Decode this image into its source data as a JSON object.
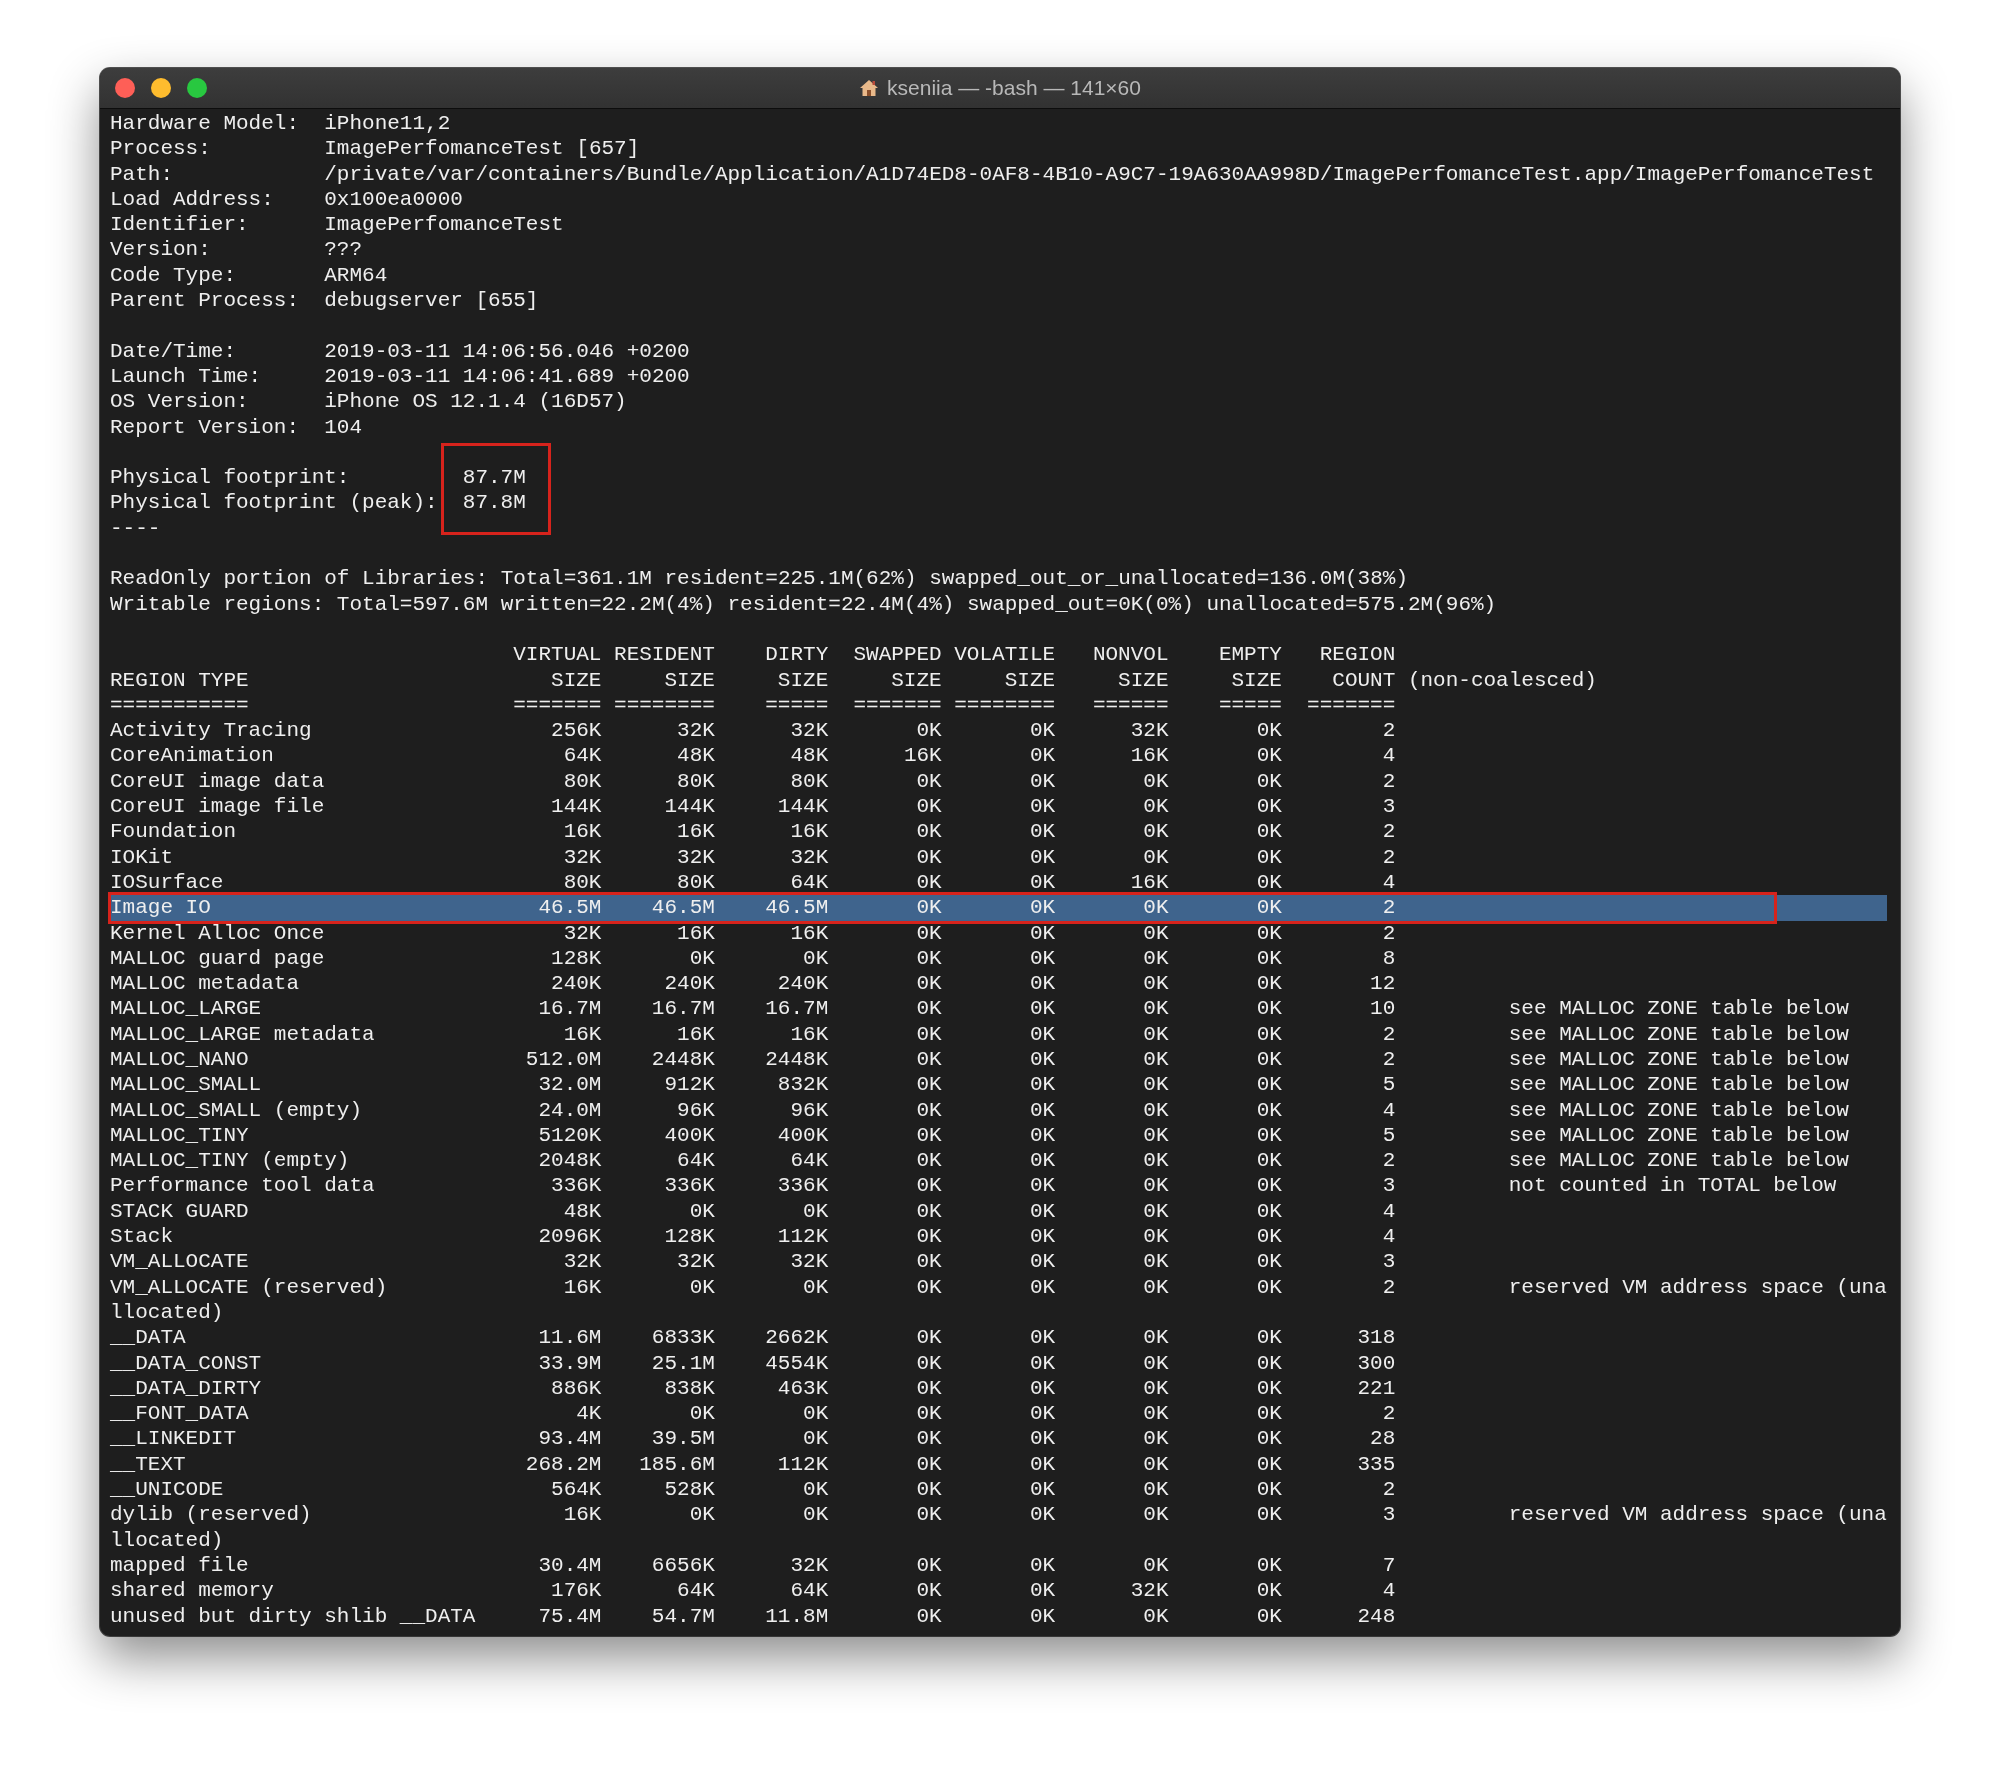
{
  "window": {
    "title": "kseniia — -bash — 141×60"
  },
  "process_info": [
    {
      "label": "Hardware Model:",
      "value": "iPhone11,2"
    },
    {
      "label": "Process:",
      "value": "ImagePerfomanceTest [657]"
    },
    {
      "label": "Path:",
      "value": "/private/var/containers/Bundle/Application/A1D74ED8-0AF8-4B10-A9C7-19A630AA998D/ImagePerfomanceTest.app/ImagePerfomanceTest"
    },
    {
      "label": "Load Address:",
      "value": "0x100ea0000"
    },
    {
      "label": "Identifier:",
      "value": "ImagePerfomanceTest"
    },
    {
      "label": "Version:",
      "value": "???"
    },
    {
      "label": "Code Type:",
      "value": "ARM64"
    },
    {
      "label": "Parent Process:",
      "value": "debugserver [655]"
    }
  ],
  "time_info": [
    {
      "label": "Date/Time:",
      "value": "2019-03-11 14:06:56.046 +0200"
    },
    {
      "label": "Launch Time:",
      "value": "2019-03-11 14:06:41.689 +0200"
    },
    {
      "label": "OS Version:",
      "value": "iPhone OS 12.1.4 (16D57)"
    },
    {
      "label": "Report Version:",
      "value": "104"
    }
  ],
  "footprint": {
    "outlined": true,
    "items": [
      {
        "label": "Physical footprint:",
        "value": "87.7M"
      },
      {
        "label": "Physical footprint (peak):",
        "value": "87.8M"
      }
    ],
    "separator": "----"
  },
  "summary": [
    "ReadOnly portion of Libraries: Total=361.1M resident=225.1M(62%) swapped_out_or_unallocated=136.0M(38%)",
    "Writable regions: Total=597.6M written=22.2M(4%) resident=22.4M(4%) swapped_out=0K(0%) unallocated=575.2M(96%)"
  ],
  "region_table": {
    "columns": [
      {
        "line_2": "REGION TYPE",
        "rule": "==========="
      },
      {
        "line_1": "VIRTUAL",
        "line_2": "SIZE",
        "rule": "======="
      },
      {
        "line_1": "RESIDENT",
        "line_2": "SIZE",
        "rule": "========"
      },
      {
        "line_1": "DIRTY",
        "line_2": "SIZE",
        "rule": "====="
      },
      {
        "line_1": "SWAPPED",
        "line_2": "SIZE",
        "rule": "======="
      },
      {
        "line_1": "VOLATILE",
        "line_2": "SIZE",
        "rule": "========"
      },
      {
        "line_1": "NONVOL",
        "line_2": "SIZE",
        "rule": "======"
      },
      {
        "line_1": "EMPTY",
        "line_2": "SIZE",
        "rule": "====="
      },
      {
        "line_1": "REGION",
        "line_2": "COUNT",
        "rule": "======="
      }
    ],
    "header_note": "(non-coalesced)",
    "rows": [
      {
        "cells": [
          "Activity Tracing",
          "256K",
          "32K",
          "32K",
          "0K",
          "0K",
          "32K",
          "0K",
          "2"
        ],
        "selected": false,
        "outlined": false
      },
      {
        "cells": [
          "CoreAnimation",
          "64K",
          "48K",
          "48K",
          "16K",
          "0K",
          "16K",
          "0K",
          "4"
        ],
        "selected": false,
        "outlined": false
      },
      {
        "cells": [
          "CoreUI image data",
          "80K",
          "80K",
          "80K",
          "0K",
          "0K",
          "0K",
          "0K",
          "2"
        ],
        "selected": false,
        "outlined": false
      },
      {
        "cells": [
          "CoreUI image file",
          "144K",
          "144K",
          "144K",
          "0K",
          "0K",
          "0K",
          "0K",
          "3"
        ],
        "selected": false,
        "outlined": false
      },
      {
        "cells": [
          "Foundation",
          "16K",
          "16K",
          "16K",
          "0K",
          "0K",
          "0K",
          "0K",
          "2"
        ],
        "selected": false,
        "outlined": false
      },
      {
        "cells": [
          "IOKit",
          "32K",
          "32K",
          "32K",
          "0K",
          "0K",
          "0K",
          "0K",
          "2"
        ],
        "selected": false,
        "outlined": false
      },
      {
        "cells": [
          "IOSurface",
          "80K",
          "80K",
          "64K",
          "0K",
          "0K",
          "16K",
          "0K",
          "4"
        ],
        "selected": false,
        "outlined": false
      },
      {
        "cells": [
          "Image IO",
          "46.5M",
          "46.5M",
          "46.5M",
          "0K",
          "0K",
          "0K",
          "0K",
          "2"
        ],
        "selected": true,
        "outlined": true
      },
      {
        "cells": [
          "Kernel Alloc Once",
          "32K",
          "16K",
          "16K",
          "0K",
          "0K",
          "0K",
          "0K",
          "2"
        ],
        "selected": false,
        "outlined": false
      },
      {
        "cells": [
          "MALLOC guard page",
          "128K",
          "0K",
          "0K",
          "0K",
          "0K",
          "0K",
          "0K",
          "8"
        ],
        "selected": false,
        "outlined": false
      },
      {
        "cells": [
          "MALLOC metadata",
          "240K",
          "240K",
          "240K",
          "0K",
          "0K",
          "0K",
          "0K",
          "12"
        ],
        "selected": false,
        "outlined": false
      },
      {
        "cells": [
          "MALLOC_LARGE",
          "16.7M",
          "16.7M",
          "16.7M",
          "0K",
          "0K",
          "0K",
          "0K",
          "10"
        ],
        "note": "see MALLOC ZONE table below",
        "selected": false,
        "outlined": false
      },
      {
        "cells": [
          "MALLOC_LARGE metadata",
          "16K",
          "16K",
          "16K",
          "0K",
          "0K",
          "0K",
          "0K",
          "2"
        ],
        "note": "see MALLOC ZONE table below",
        "selected": false,
        "outlined": false
      },
      {
        "cells": [
          "MALLOC_NANO",
          "512.0M",
          "2448K",
          "2448K",
          "0K",
          "0K",
          "0K",
          "0K",
          "2"
        ],
        "note": "see MALLOC ZONE table below",
        "selected": false,
        "outlined": false
      },
      {
        "cells": [
          "MALLOC_SMALL",
          "32.0M",
          "912K",
          "832K",
          "0K",
          "0K",
          "0K",
          "0K",
          "5"
        ],
        "note": "see MALLOC ZONE table below",
        "selected": false,
        "outlined": false
      },
      {
        "cells": [
          "MALLOC_SMALL (empty)",
          "24.0M",
          "96K",
          "96K",
          "0K",
          "0K",
          "0K",
          "0K",
          "4"
        ],
        "note": "see MALLOC ZONE table below",
        "selected": false,
        "outlined": false
      },
      {
        "cells": [
          "MALLOC_TINY",
          "5120K",
          "400K",
          "400K",
          "0K",
          "0K",
          "0K",
          "0K",
          "5"
        ],
        "note": "see MALLOC ZONE table below",
        "selected": false,
        "outlined": false
      },
      {
        "cells": [
          "MALLOC_TINY (empty)",
          "2048K",
          "64K",
          "64K",
          "0K",
          "0K",
          "0K",
          "0K",
          "2"
        ],
        "note": "see MALLOC ZONE table below",
        "selected": false,
        "outlined": false
      },
      {
        "cells": [
          "Performance tool data",
          "336K",
          "336K",
          "336K",
          "0K",
          "0K",
          "0K",
          "0K",
          "3"
        ],
        "note": "not counted in TOTAL below",
        "selected": false,
        "outlined": false
      },
      {
        "cells": [
          "STACK GUARD",
          "48K",
          "0K",
          "0K",
          "0K",
          "0K",
          "0K",
          "0K",
          "4"
        ],
        "selected": false,
        "outlined": false
      },
      {
        "cells": [
          "Stack",
          "2096K",
          "128K",
          "112K",
          "0K",
          "0K",
          "0K",
          "0K",
          "4"
        ],
        "selected": false,
        "outlined": false
      },
      {
        "cells": [
          "VM_ALLOCATE",
          "32K",
          "32K",
          "32K",
          "0K",
          "0K",
          "0K",
          "0K",
          "3"
        ],
        "selected": false,
        "outlined": false
      },
      {
        "cells": [
          "VM_ALLOCATE (reserved)",
          "16K",
          "0K",
          "0K",
          "0K",
          "0K",
          "0K",
          "0K",
          "2"
        ],
        "note": "reserved VM address space (una",
        "wrap": "llocated)",
        "selected": false,
        "outlined": false
      },
      {
        "cells": [
          "__DATA",
          "11.6M",
          "6833K",
          "2662K",
          "0K",
          "0K",
          "0K",
          "0K",
          "318"
        ],
        "selected": false,
        "outlined": false
      },
      {
        "cells": [
          "__DATA_CONST",
          "33.9M",
          "25.1M",
          "4554K",
          "0K",
          "0K",
          "0K",
          "0K",
          "300"
        ],
        "selected": false,
        "outlined": false
      },
      {
        "cells": [
          "__DATA_DIRTY",
          "886K",
          "838K",
          "463K",
          "0K",
          "0K",
          "0K",
          "0K",
          "221"
        ],
        "selected": false,
        "outlined": false
      },
      {
        "cells": [
          "__FONT_DATA",
          "4K",
          "0K",
          "0K",
          "0K",
          "0K",
          "0K",
          "0K",
          "2"
        ],
        "selected": false,
        "outlined": false
      },
      {
        "cells": [
          "__LINKEDIT",
          "93.4M",
          "39.5M",
          "0K",
          "0K",
          "0K",
          "0K",
          "0K",
          "28"
        ],
        "selected": false,
        "outlined": false
      },
      {
        "cells": [
          "__TEXT",
          "268.2M",
          "185.6M",
          "112K",
          "0K",
          "0K",
          "0K",
          "0K",
          "335"
        ],
        "selected": false,
        "outlined": false
      },
      {
        "cells": [
          "__UNICODE",
          "564K",
          "528K",
          "0K",
          "0K",
          "0K",
          "0K",
          "0K",
          "2"
        ],
        "selected": false,
        "outlined": false
      },
      {
        "cells": [
          "dylib (reserved)",
          "16K",
          "0K",
          "0K",
          "0K",
          "0K",
          "0K",
          "0K",
          "3"
        ],
        "note": "reserved VM address space (una",
        "wrap": "llocated)",
        "selected": false,
        "outlined": false
      },
      {
        "cells": [
          "mapped file",
          "30.4M",
          "6656K",
          "32K",
          "0K",
          "0K",
          "0K",
          "0K",
          "7"
        ],
        "selected": false,
        "outlined": false
      },
      {
        "cells": [
          "shared memory",
          "176K",
          "64K",
          "64K",
          "0K",
          "0K",
          "32K",
          "0K",
          "4"
        ],
        "selected": false,
        "outlined": false
      },
      {
        "cells": [
          "unused but dirty shlib __DATA",
          "75.4M",
          "54.7M",
          "11.8M",
          "0K",
          "0K",
          "0K",
          "0K",
          "248"
        ],
        "selected": false,
        "outlined": false
      }
    ]
  }
}
